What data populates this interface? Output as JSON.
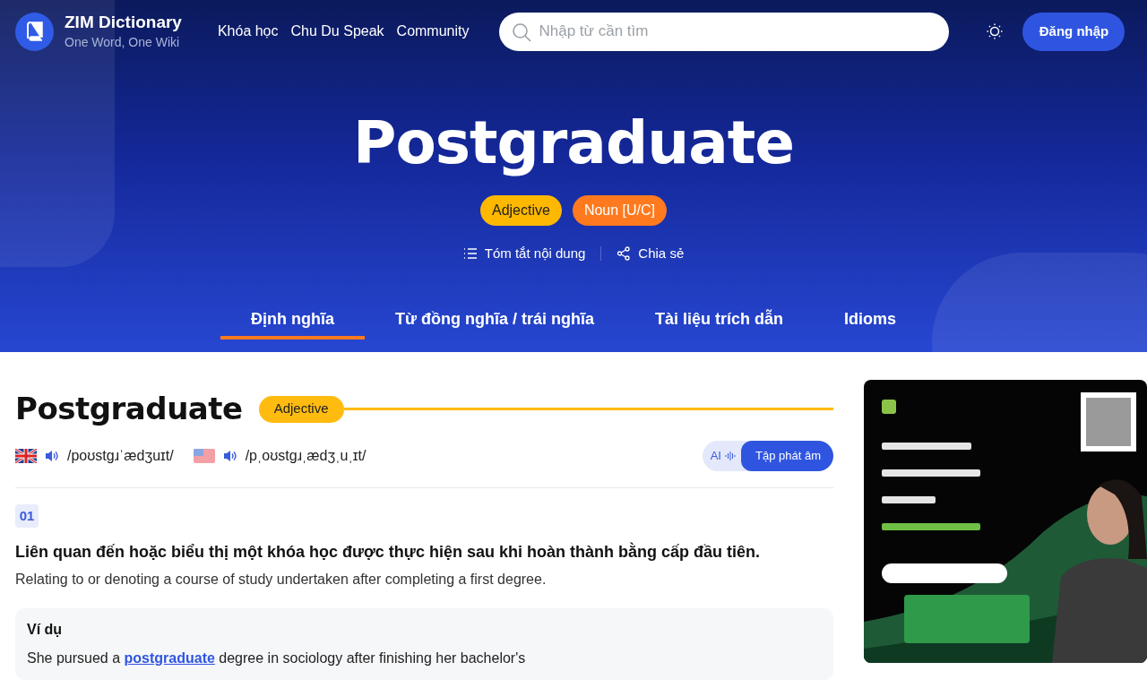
{
  "brand": {
    "name": "ZIM Dictionary",
    "tagline": "One Word, One Wiki"
  },
  "nav": [
    "Khóa học",
    "Chu Du Speak",
    "Community"
  ],
  "search": {
    "placeholder": "Nhập từ cần tìm"
  },
  "login": "Đăng nhập",
  "hero": {
    "word": "Postgraduate",
    "pos": [
      {
        "label": "Adjective",
        "color": "#ffb800"
      },
      {
        "label": "Noun [U/C]",
        "color": "#ff7a1f"
      }
    ],
    "actions": [
      {
        "kind": "summary",
        "label": "Tóm tắt nội dung"
      },
      {
        "kind": "share",
        "label": "Chia sẻ"
      }
    ]
  },
  "tabs": [
    {
      "label": "Định nghĩa",
      "selected": true
    },
    {
      "label": "Từ đồng nghĩa / trái nghĩa",
      "selected": false
    },
    {
      "label": "Tài liệu trích dẫn",
      "selected": false
    },
    {
      "label": "Idioms",
      "selected": false
    }
  ],
  "entry": {
    "word": "Postgraduate",
    "pos": "Adjective",
    "pronunciations": [
      {
        "kind": "uk",
        "ipa": "/poʊstgɹˈædʒuɪt/"
      },
      {
        "kind": "us",
        "ipa": "/pˌoʊstgɹˌædʒˌuˌɪt/"
      }
    ],
    "ai_button": {
      "ai": "AI",
      "label": "Tập phát âm"
    },
    "senses": [
      {
        "number": "01",
        "vi": "Liên quan đến hoặc biểu thị một khóa học được thực hiện sau khi hoàn thành bằng cấp đầu tiên.",
        "en": "Relating to or denoting a course of study undertaken after completing a first degree.",
        "example_title": "Ví dụ",
        "example": {
          "before": "She pursued a ",
          "link": "postgraduate",
          "after": " degree in sociology after finishing her bachelor's"
        }
      }
    ]
  },
  "ad": {
    "kind": "picture"
  }
}
